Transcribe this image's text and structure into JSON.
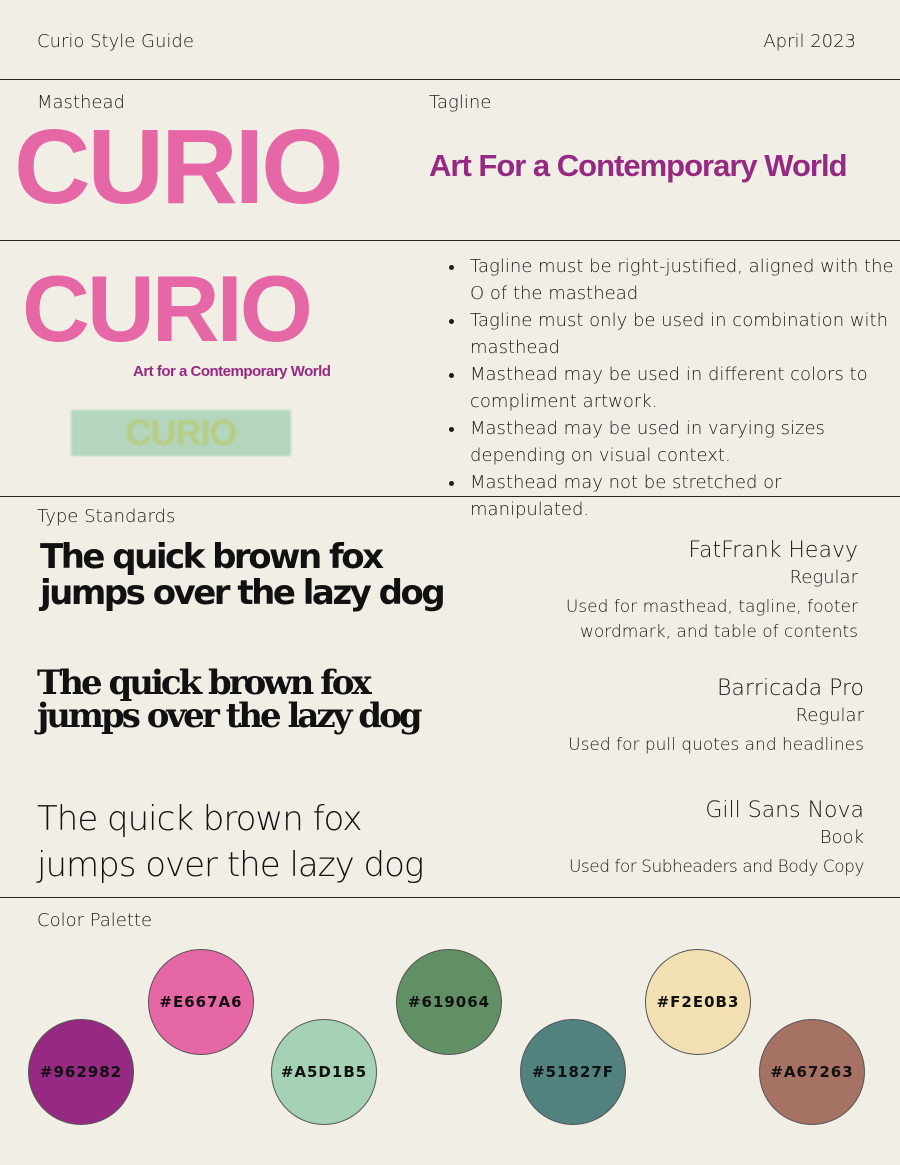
{
  "header": {
    "title": "Curio Style Guide",
    "date": "April 2023"
  },
  "masthead_section": {
    "masthead_label": "Masthead",
    "tagline_label": "Tagline",
    "masthead_text": "CURIO",
    "tagline_text": "Art For a Contemporary World"
  },
  "usage_section": {
    "combo_masthead": "CURIO",
    "combo_tagline": "Art for a Contemporary World",
    "alt_masthead": "CURIO",
    "rules": [
      "Tagline must be right-justified, aligned with the O of the masthead",
      "Tagline must only be used in combination with masthead",
      "Masthead may be used in different colors to compliment artwork.",
      "Masthead may be used in varying sizes depending on visual context.",
      "Masthead may not be stretched or manipulated."
    ]
  },
  "type_section": {
    "label": "Type Standards",
    "fonts": [
      {
        "sample": "The quick brown fox jumps over the lazy dog",
        "name": "FatFrank Heavy",
        "style": "Regular",
        "usage": "Used for masthead, tagline, footer wordmark, and table of contents"
      },
      {
        "sample": "The quick brown fox jumps over the lazy dog",
        "name": "Barricada Pro",
        "style": "Regular",
        "usage": "Used for pull quotes and headlines"
      },
      {
        "sample": "The quick brown fox jumps over the lazy dog",
        "name": "Gill Sans Nova",
        "style": "Book",
        "usage": "Used for Subheaders and Body Copy"
      }
    ]
  },
  "color_section": {
    "label": "Color Palette",
    "swatches": [
      {
        "hex": "#962982",
        "color": "#962982"
      },
      {
        "hex": "#E667A6",
        "color": "#e667a6"
      },
      {
        "hex": "#A5D1B5",
        "color": "#a5d1b5"
      },
      {
        "hex": "#619064",
        "color": "#619064"
      },
      {
        "hex": "#51827F",
        "color": "#51827f"
      },
      {
        "hex": "#F2E0B3",
        "color": "#f2e0b3"
      },
      {
        "hex": "#A67263",
        "color": "#a67263"
      }
    ]
  }
}
